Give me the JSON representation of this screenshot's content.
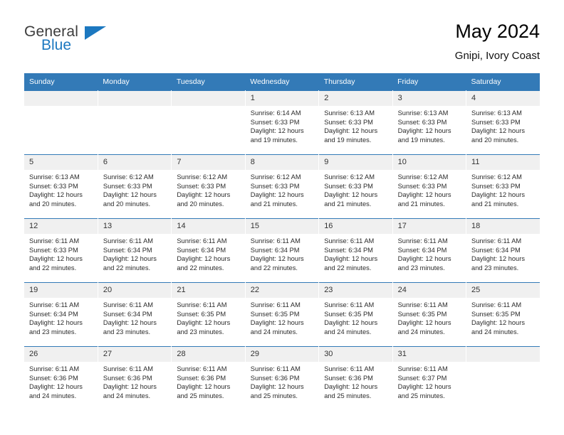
{
  "brand": {
    "name_top": "General",
    "name_bottom": "Blue",
    "accent_color": "#1c78c0",
    "triangle_icon": "triangle-icon"
  },
  "header": {
    "title": "May 2024",
    "subtitle": "Gnipi, Ivory Coast"
  },
  "calendar": {
    "header_bg": "#337ab7",
    "header_text_color": "#ffffff",
    "daynum_bg": "#f0f0f0",
    "weekdays": [
      "Sunday",
      "Monday",
      "Tuesday",
      "Wednesday",
      "Thursday",
      "Friday",
      "Saturday"
    ],
    "weeks": [
      [
        {
          "day": "",
          "lines": []
        },
        {
          "day": "",
          "lines": []
        },
        {
          "day": "",
          "lines": []
        },
        {
          "day": "1",
          "lines": [
            "Sunrise: 6:14 AM",
            "Sunset: 6:33 PM",
            "Daylight: 12 hours",
            "and 19 minutes."
          ]
        },
        {
          "day": "2",
          "lines": [
            "Sunrise: 6:13 AM",
            "Sunset: 6:33 PM",
            "Daylight: 12 hours",
            "and 19 minutes."
          ]
        },
        {
          "day": "3",
          "lines": [
            "Sunrise: 6:13 AM",
            "Sunset: 6:33 PM",
            "Daylight: 12 hours",
            "and 19 minutes."
          ]
        },
        {
          "day": "4",
          "lines": [
            "Sunrise: 6:13 AM",
            "Sunset: 6:33 PM",
            "Daylight: 12 hours",
            "and 20 minutes."
          ]
        }
      ],
      [
        {
          "day": "5",
          "lines": [
            "Sunrise: 6:13 AM",
            "Sunset: 6:33 PM",
            "Daylight: 12 hours",
            "and 20 minutes."
          ]
        },
        {
          "day": "6",
          "lines": [
            "Sunrise: 6:12 AM",
            "Sunset: 6:33 PM",
            "Daylight: 12 hours",
            "and 20 minutes."
          ]
        },
        {
          "day": "7",
          "lines": [
            "Sunrise: 6:12 AM",
            "Sunset: 6:33 PM",
            "Daylight: 12 hours",
            "and 20 minutes."
          ]
        },
        {
          "day": "8",
          "lines": [
            "Sunrise: 6:12 AM",
            "Sunset: 6:33 PM",
            "Daylight: 12 hours",
            "and 21 minutes."
          ]
        },
        {
          "day": "9",
          "lines": [
            "Sunrise: 6:12 AM",
            "Sunset: 6:33 PM",
            "Daylight: 12 hours",
            "and 21 minutes."
          ]
        },
        {
          "day": "10",
          "lines": [
            "Sunrise: 6:12 AM",
            "Sunset: 6:33 PM",
            "Daylight: 12 hours",
            "and 21 minutes."
          ]
        },
        {
          "day": "11",
          "lines": [
            "Sunrise: 6:12 AM",
            "Sunset: 6:33 PM",
            "Daylight: 12 hours",
            "and 21 minutes."
          ]
        }
      ],
      [
        {
          "day": "12",
          "lines": [
            "Sunrise: 6:11 AM",
            "Sunset: 6:33 PM",
            "Daylight: 12 hours",
            "and 22 minutes."
          ]
        },
        {
          "day": "13",
          "lines": [
            "Sunrise: 6:11 AM",
            "Sunset: 6:34 PM",
            "Daylight: 12 hours",
            "and 22 minutes."
          ]
        },
        {
          "day": "14",
          "lines": [
            "Sunrise: 6:11 AM",
            "Sunset: 6:34 PM",
            "Daylight: 12 hours",
            "and 22 minutes."
          ]
        },
        {
          "day": "15",
          "lines": [
            "Sunrise: 6:11 AM",
            "Sunset: 6:34 PM",
            "Daylight: 12 hours",
            "and 22 minutes."
          ]
        },
        {
          "day": "16",
          "lines": [
            "Sunrise: 6:11 AM",
            "Sunset: 6:34 PM",
            "Daylight: 12 hours",
            "and 22 minutes."
          ]
        },
        {
          "day": "17",
          "lines": [
            "Sunrise: 6:11 AM",
            "Sunset: 6:34 PM",
            "Daylight: 12 hours",
            "and 23 minutes."
          ]
        },
        {
          "day": "18",
          "lines": [
            "Sunrise: 6:11 AM",
            "Sunset: 6:34 PM",
            "Daylight: 12 hours",
            "and 23 minutes."
          ]
        }
      ],
      [
        {
          "day": "19",
          "lines": [
            "Sunrise: 6:11 AM",
            "Sunset: 6:34 PM",
            "Daylight: 12 hours",
            "and 23 minutes."
          ]
        },
        {
          "day": "20",
          "lines": [
            "Sunrise: 6:11 AM",
            "Sunset: 6:34 PM",
            "Daylight: 12 hours",
            "and 23 minutes."
          ]
        },
        {
          "day": "21",
          "lines": [
            "Sunrise: 6:11 AM",
            "Sunset: 6:35 PM",
            "Daylight: 12 hours",
            "and 23 minutes."
          ]
        },
        {
          "day": "22",
          "lines": [
            "Sunrise: 6:11 AM",
            "Sunset: 6:35 PM",
            "Daylight: 12 hours",
            "and 24 minutes."
          ]
        },
        {
          "day": "23",
          "lines": [
            "Sunrise: 6:11 AM",
            "Sunset: 6:35 PM",
            "Daylight: 12 hours",
            "and 24 minutes."
          ]
        },
        {
          "day": "24",
          "lines": [
            "Sunrise: 6:11 AM",
            "Sunset: 6:35 PM",
            "Daylight: 12 hours",
            "and 24 minutes."
          ]
        },
        {
          "day": "25",
          "lines": [
            "Sunrise: 6:11 AM",
            "Sunset: 6:35 PM",
            "Daylight: 12 hours",
            "and 24 minutes."
          ]
        }
      ],
      [
        {
          "day": "26",
          "lines": [
            "Sunrise: 6:11 AM",
            "Sunset: 6:36 PM",
            "Daylight: 12 hours",
            "and 24 minutes."
          ]
        },
        {
          "day": "27",
          "lines": [
            "Sunrise: 6:11 AM",
            "Sunset: 6:36 PM",
            "Daylight: 12 hours",
            "and 24 minutes."
          ]
        },
        {
          "day": "28",
          "lines": [
            "Sunrise: 6:11 AM",
            "Sunset: 6:36 PM",
            "Daylight: 12 hours",
            "and 25 minutes."
          ]
        },
        {
          "day": "29",
          "lines": [
            "Sunrise: 6:11 AM",
            "Sunset: 6:36 PM",
            "Daylight: 12 hours",
            "and 25 minutes."
          ]
        },
        {
          "day": "30",
          "lines": [
            "Sunrise: 6:11 AM",
            "Sunset: 6:36 PM",
            "Daylight: 12 hours",
            "and 25 minutes."
          ]
        },
        {
          "day": "31",
          "lines": [
            "Sunrise: 6:11 AM",
            "Sunset: 6:37 PM",
            "Daylight: 12 hours",
            "and 25 minutes."
          ]
        },
        {
          "day": "",
          "lines": []
        }
      ]
    ]
  }
}
